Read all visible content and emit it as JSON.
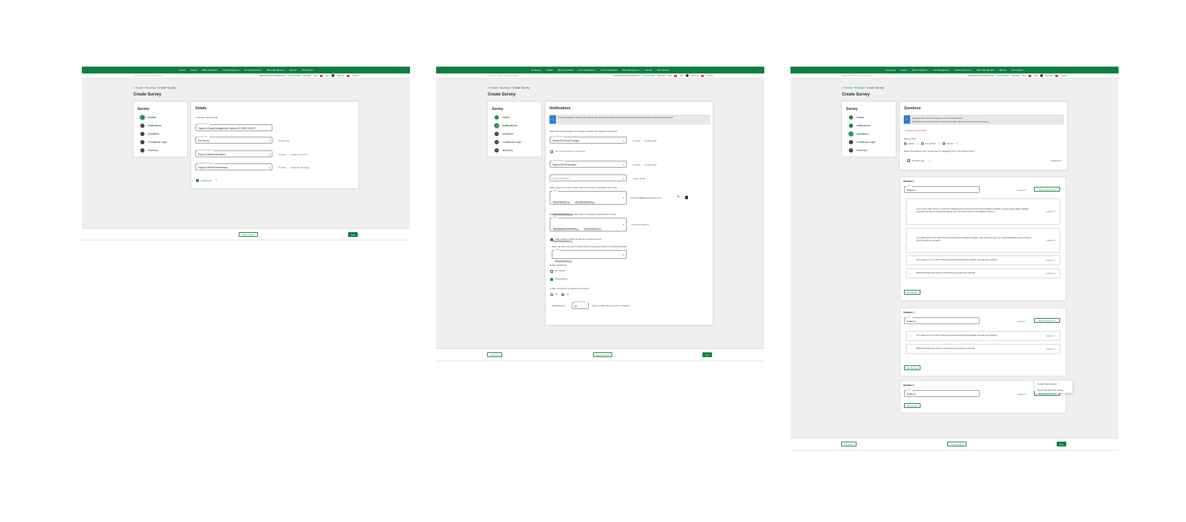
{
  "top_nav_1": [
    "Journey",
    "Payroll",
    "Talent Acquisition",
    "Time Management",
    "Human Resources",
    "Talent Management",
    "Reports",
    "User Options"
  ],
  "top_nav_2": [
    "Employees",
    "Payroll",
    "Talent Acquisition",
    "Time Management",
    "Human Resources",
    "Talent Management",
    "Reports",
    "User Options"
  ],
  "sub_bar": {
    "left": "Kelsey Harris (1000) - Agile Enterprise(A)",
    "company": "QUENCHED ACE SMARTEOLOGY",
    "edit": "FOLIO ACCESS",
    "new": "New Menu",
    "help": "Help",
    "user": "Quendres",
    "logout": "Log Out"
  },
  "breadcrumb": {
    "home": "Home",
    "surveys": "Surveys",
    "current": "Create Survey"
  },
  "page_title": "Create Survey",
  "stepper": {
    "title": "Survey",
    "steps": [
      "Details",
      "Notifications",
      "Questions",
      "Conditional Logic",
      "Summary"
    ]
  },
  "details": {
    "title": "Details",
    "required_note": "* Indicates required field",
    "survey_name_label": "Survey Name *",
    "survey_name_value": "Paycom's Quality Management System (ISO 9001:2015) Fi...",
    "survey_type_label": "Survey Type *",
    "survey_type_value": "Exit Survey",
    "create_type": "Create Type",
    "instructions_label": "Survey Instructions *",
    "instructions_value": "Paycom Default Instructions",
    "exit_message_label": "Survey Exit Message *",
    "exit_message_value": "Paycom Default Exit Message",
    "preview": "Preview",
    "create_instructions": "Create Instructions",
    "create_exit_message": "Create Exit Message",
    "anonymous": "Anonymous"
  },
  "footer": {
    "previous": "Previous",
    "save_exit": "Save and Exit",
    "next": "Next"
  },
  "notifications": {
    "title": "Notifications",
    "info": "If no email template is selected, the employee will not receive an email reminder for the survey and will only be notified in Employee Self Service®.",
    "select_templates": "Select the email templates you require to send to the assigned employees.",
    "email_template_label": "Email Template",
    "email_template_value": "Default Exit Email Template",
    "use_same": "Use email template for all notifications",
    "reminder_label": "Email Reminder",
    "reminder_value": "Paycom Email Reminder",
    "completion_placeholder": "Email Completion",
    "preview": "Preview",
    "create_email": "Create Email",
    "notify_assigned": "Select whom you want to notify when an employee is assigned the survey.",
    "notify_label": "Notify",
    "assigned_chips": [
      "Primary Supervisor",
      "Secondary Supervisor",
      "Custom Email Address"
    ],
    "custom_email": "customemail@paycomonline.com",
    "notify_completes": "Select whom you want to notify when an employee completes the survey.",
    "completes_chips": [
      "Talent Management Supervisor",
      "Time off supervisor",
      "Custom Email Address"
    ],
    "add_email_address": "Add Email Address",
    "notify_conditional": "Notify a different recipient for selected conditional answers",
    "select_all_conditional": "Select all whom you want to notify when an employee selects a conditional answer.",
    "conditional_chips": [
      "Primary Supervisor"
    ],
    "default_notification": "Default Notification",
    "via_in_email": "Via In Email",
    "personal_email": "Personal Email",
    "time_limit_q": "Is there a time limit to complete the survey?",
    "no": "No",
    "yes": "Yes",
    "employees_have": "Employees have",
    "days_label": "Number of days *",
    "days_value": "30",
    "days_suffix": "days to complete the survey after it is assigned"
  },
  "questions": {
    "title": "Questions",
    "info1": "Questions will be shown to employees in the order listed below.",
    "info2": "Notifications from questions with Conditional Notifications will not be sent on anonymous surveys",
    "required_note": "* Indicates required field",
    "survey_view_label": "Survey View *",
    "view_options": [
      "Classic",
      "Per question",
      "Sections"
    ],
    "select_reorder": "Select the questions and reorder them by dragging them to the desired order. *",
    "per_page_view": "Per page view",
    "collapse_all": "Collapse All",
    "title_label": "Title *",
    "actions": "Actions",
    "select_questions": "Select Questions",
    "add_section": "Add Section",
    "sections": [
      {
        "header": "Section 1",
        "title": "Section 1",
        "questions": [
          "Lorem ipsum dolor sit amet, consectetur adipiscing elit, sed do eiusmod tempor incididunt ut labore et dolore magna aliqua. Facilisis sed odio morbi quis commodo odio aenean sed. Sed viverra tellus in hac habitasse platea d...",
          "On a scale from 0 to 10, with 0 being the lowest and 10 being the highest, how would you rate your overall satisfaction of the job during your time with our company?",
          "On a scale of 1 to 10, with 1 being the lowest and 10 being the highest, how was your training?",
          "What could have been done to increase how you rated your training?"
        ]
      },
      {
        "header": "Section 2",
        "title": "Section 2",
        "questions": [
          "On a scale of 1 to 10, with 1 being the lowest and 10 being the highest, how was your training?",
          "What could have been done to increase how you rated your training?"
        ]
      },
      {
        "header": "Section 3",
        "title": "Section 3",
        "questions": []
      }
    ],
    "menu": [
      "Create New Question",
      "Select Question from Library"
    ]
  },
  "colors": {
    "brand": "#0a7f3f",
    "info": "#2a7bd4"
  }
}
